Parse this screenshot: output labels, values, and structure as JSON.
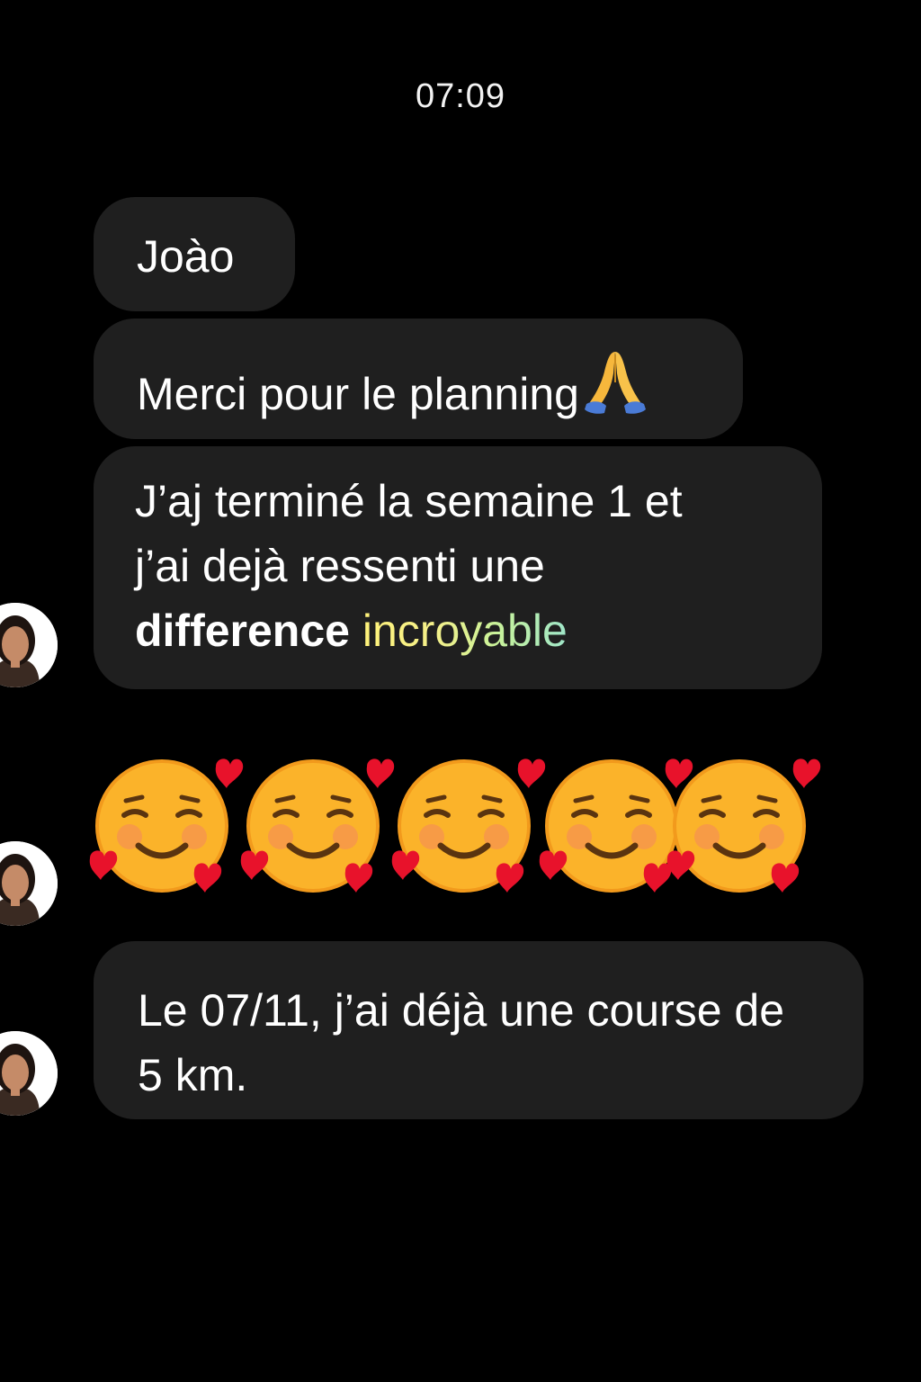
{
  "header": {
    "time": "07:09"
  },
  "messages": [
    {
      "text": "Joào"
    },
    {
      "text": "Merci pour le planning",
      "emoji": "folded-hands"
    },
    {
      "line1": "J’aj terminé la semaine 1 et",
      "line2": "j’ai dejà ressenti une",
      "bold_word": "difference",
      "highlight_word": "incroyable"
    },
    {
      "emoji_name": "smiling-face-with-hearts",
      "count": 5
    },
    {
      "text": "Le 07/11, j’ai déjà une course de 5 km."
    }
  ],
  "colors": {
    "background": "#000000",
    "bubble": "#1f1f1f",
    "text": "#ffffff",
    "highlight_start": "#fff27a",
    "highlight_end": "#9fe6c9"
  }
}
